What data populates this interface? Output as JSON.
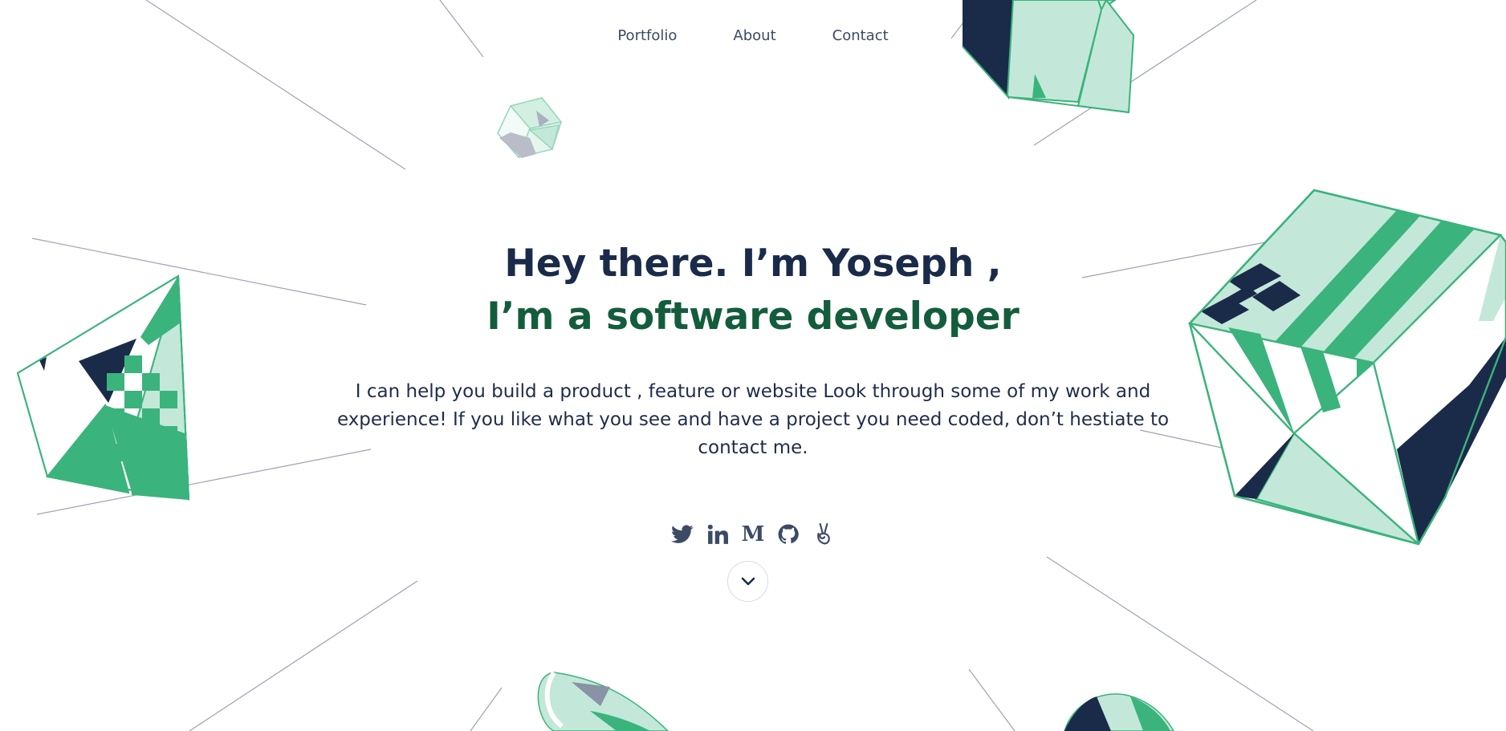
{
  "nav": {
    "portfolio": "Portfolio",
    "about": "About",
    "contact": "Contact"
  },
  "hero": {
    "line1": "Hey there. I’m Yoseph ,",
    "line2": "I’m a software developer",
    "intro": "I can help you build a product , feature or website Look through some of my work and experience! If you like what you see and have a project you need coded, don’t hestiate to contact me."
  },
  "socials": [
    "twitter-icon",
    "linkedin-icon",
    "medium-icon",
    "github-icon",
    "angellist-icon"
  ],
  "medium_letter": "M",
  "colors": {
    "navy": "#1a2b4a",
    "green_dark": "#135d3c",
    "green": "#3bb37c",
    "mint": "#c3e8d9",
    "line_gray": "#9da3b4"
  }
}
